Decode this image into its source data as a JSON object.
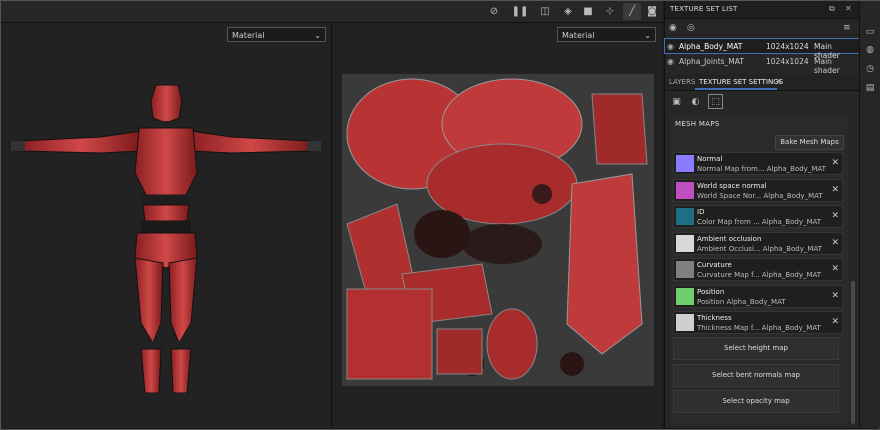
{
  "viewport": {
    "left_select": "Material",
    "right_select": "Material"
  },
  "toolbar": {
    "icons": [
      "hide-icon",
      "pause-icon",
      "split-view-icon",
      "cube-icon",
      "camera-video-icon",
      "axes-icon",
      "brush-icon",
      "screenshot-icon"
    ]
  },
  "texture_set_list": {
    "title": "TEXTURE SET LIST",
    "rows": [
      {
        "name": "Alpha_Body_MAT",
        "size": "1024x1024",
        "shader": "Main shader",
        "selected": true
      },
      {
        "name": "Alpha_Joints_MAT",
        "size": "1024x1024",
        "shader": "Main shader",
        "selected": false
      }
    ]
  },
  "tabs": {
    "layers": "LAYERS",
    "settings": "TEXTURE SET SETTINGS",
    "close": "✕"
  },
  "mesh_maps": {
    "title": "MESH MAPS",
    "bake_label": "Bake Mesh Maps",
    "maps": [
      {
        "name": "Normal",
        "desc": "Normal Map from... Alpha_Body_MAT",
        "color": "#8a7cff"
      },
      {
        "name": "World space normal",
        "desc": "World Space Nor... Alpha_Body_MAT",
        "color": "#c050c0"
      },
      {
        "name": "ID",
        "desc": "Color Map from ... Alpha_Body_MAT",
        "color": "#1f6f84"
      },
      {
        "name": "Ambient occlusion",
        "desc": "Ambient Occlusi... Alpha_Body_MAT",
        "color": "#d8d8d8"
      },
      {
        "name": "Curvature",
        "desc": "Curvature Map f... Alpha_Body_MAT",
        "color": "#808080"
      },
      {
        "name": "Position",
        "desc": "Position Alpha_Body_MAT",
        "color": "#6fcf6f"
      },
      {
        "name": "Thickness",
        "desc": "Thickness Map f... Alpha_Body_MAT",
        "color": "#cfcfcf"
      }
    ],
    "select_buttons": [
      "Select height map",
      "Select bent normals map",
      "Select opacity map"
    ]
  },
  "colors": {
    "accent": "#3f6fb5",
    "robot_red": "#c83a3a"
  }
}
